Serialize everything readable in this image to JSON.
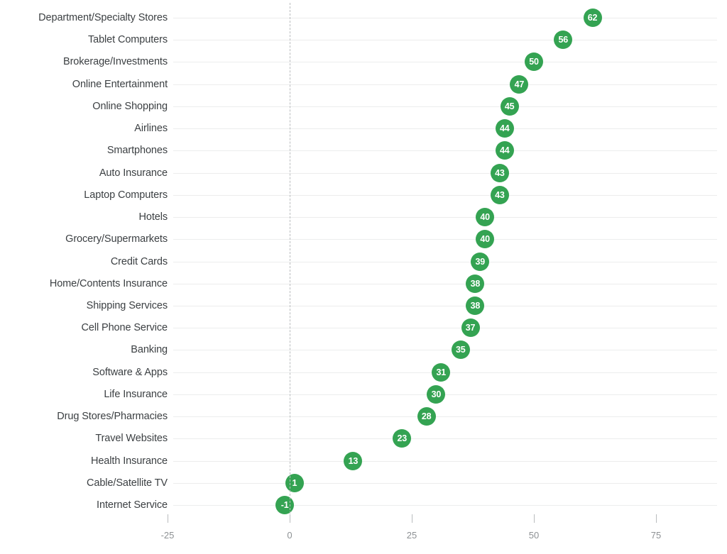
{
  "chart_data": {
    "type": "scatter",
    "orientation": "horizontal",
    "title": "",
    "subtitle": "",
    "xlabel": "",
    "ylabel": "",
    "xlim": [
      -33,
      85
    ],
    "xticks": [
      -25,
      0,
      25,
      50,
      75
    ],
    "xtick_labels": [
      "-25",
      "0",
      "25",
      "50",
      "75"
    ],
    "grid": true,
    "grid_axis": "y",
    "legend": null,
    "zero_reference_line": 0,
    "value_labels_shown": true,
    "marker": "filled-circle-with-value",
    "categories": [
      "Department/Specialty Stores",
      "Tablet Computers",
      "Brokerage/Investments",
      "Online Entertainment",
      "Online Shopping",
      "Airlines",
      "Smartphones",
      "Auto Insurance",
      "Laptop Computers",
      "Hotels",
      "Grocery/Supermarkets",
      "Credit Cards",
      "Home/Contents Insurance",
      "Shipping Services",
      "Cell Phone Service",
      "Banking",
      "Software & Apps",
      "Life Insurance",
      "Drug Stores/Pharmacies",
      "Travel Websites",
      "Health Insurance",
      "Cable/Satellite TV",
      "Internet Service"
    ],
    "values": [
      62,
      56,
      50,
      47,
      45,
      44,
      44,
      43,
      43,
      40,
      40,
      39,
      38,
      38,
      37,
      35,
      31,
      30,
      28,
      23,
      13,
      1,
      -1
    ],
    "colors": {
      "marker": "#34a352",
      "marker_text": "#ffffff",
      "gridline": "#eceded",
      "category_label": "#3c4043",
      "axis_tick": "#b9bcbe",
      "axis_label": "#8d9194",
      "zero_line": "#b9bcbe",
      "background": "#ffffff"
    }
  }
}
